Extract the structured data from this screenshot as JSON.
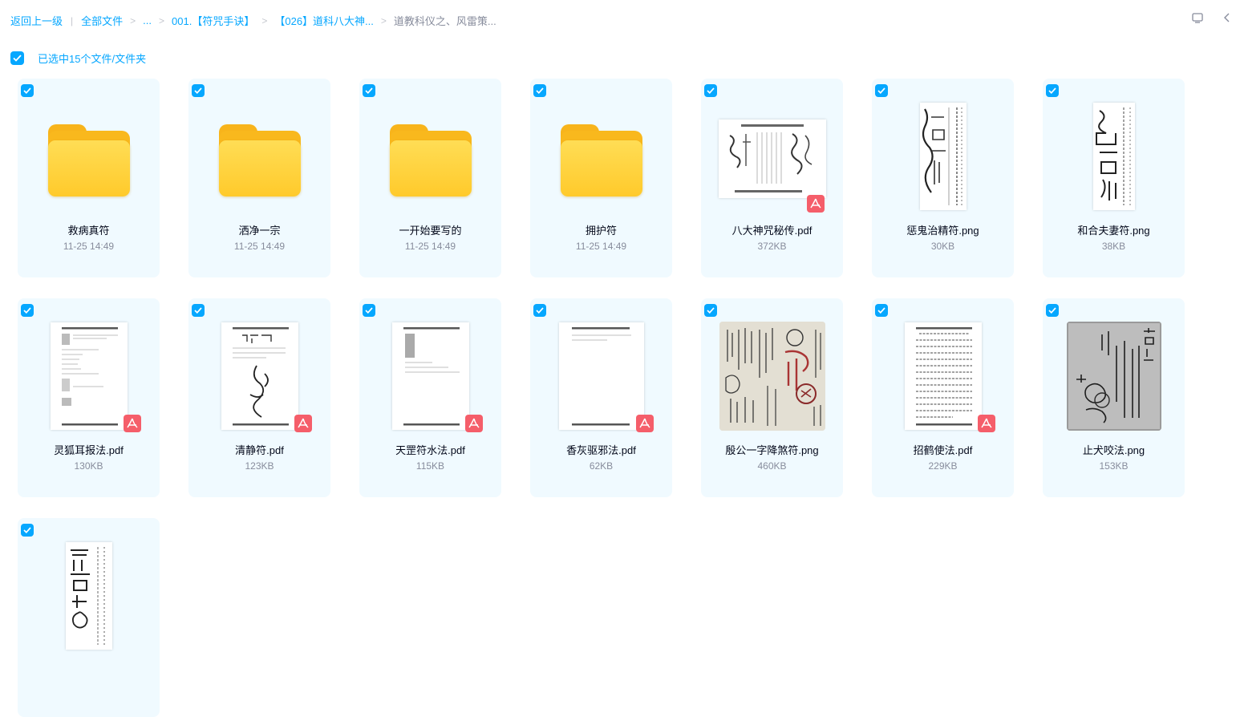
{
  "breadcrumb": {
    "back": "返回上一级",
    "all_files": "全部文件",
    "ellipsis": "...",
    "level1": "001.【符咒手诀】",
    "level2": "【026】道科八大神...",
    "current": "道教科仪之、风雷策..."
  },
  "selection": {
    "label": "已选中15个文件/文件夹"
  },
  "colors": {
    "accent": "#06a7ff",
    "card_bg": "#f0faff",
    "folder": "#ffcc2e",
    "pdf_badge": "#f55e6a"
  },
  "files": [
    {
      "name": "救病真符",
      "meta": "11-25 14:49",
      "kind": "folder"
    },
    {
      "name": "洒净一宗",
      "meta": "11-25 14:49",
      "kind": "folder"
    },
    {
      "name": "一开始要写的",
      "meta": "11-25 14:49",
      "kind": "folder"
    },
    {
      "name": "拥护符",
      "meta": "11-25 14:49",
      "kind": "folder"
    },
    {
      "name": "八大神咒秘传.pdf",
      "meta": "372KB",
      "kind": "pdf"
    },
    {
      "name": "惩鬼治精符.png",
      "meta": "30KB",
      "kind": "png"
    },
    {
      "name": "和合夫妻符.png",
      "meta": "38KB",
      "kind": "png"
    },
    {
      "name": "灵狐耳报法.pdf",
      "meta": "130KB",
      "kind": "pdf"
    },
    {
      "name": "清静符.pdf",
      "meta": "123KB",
      "kind": "pdf"
    },
    {
      "name": "天罡符水法.pdf",
      "meta": "115KB",
      "kind": "pdf"
    },
    {
      "name": "香灰驱邪法.pdf",
      "meta": "62KB",
      "kind": "pdf"
    },
    {
      "name": "殷公一字降煞符.png",
      "meta": "460KB",
      "kind": "png"
    },
    {
      "name": "招鹤使法.pdf",
      "meta": "229KB",
      "kind": "pdf"
    },
    {
      "name": "止犬咬法.png",
      "meta": "153KB",
      "kind": "png"
    },
    {
      "name": "",
      "meta": "",
      "kind": "png"
    }
  ]
}
